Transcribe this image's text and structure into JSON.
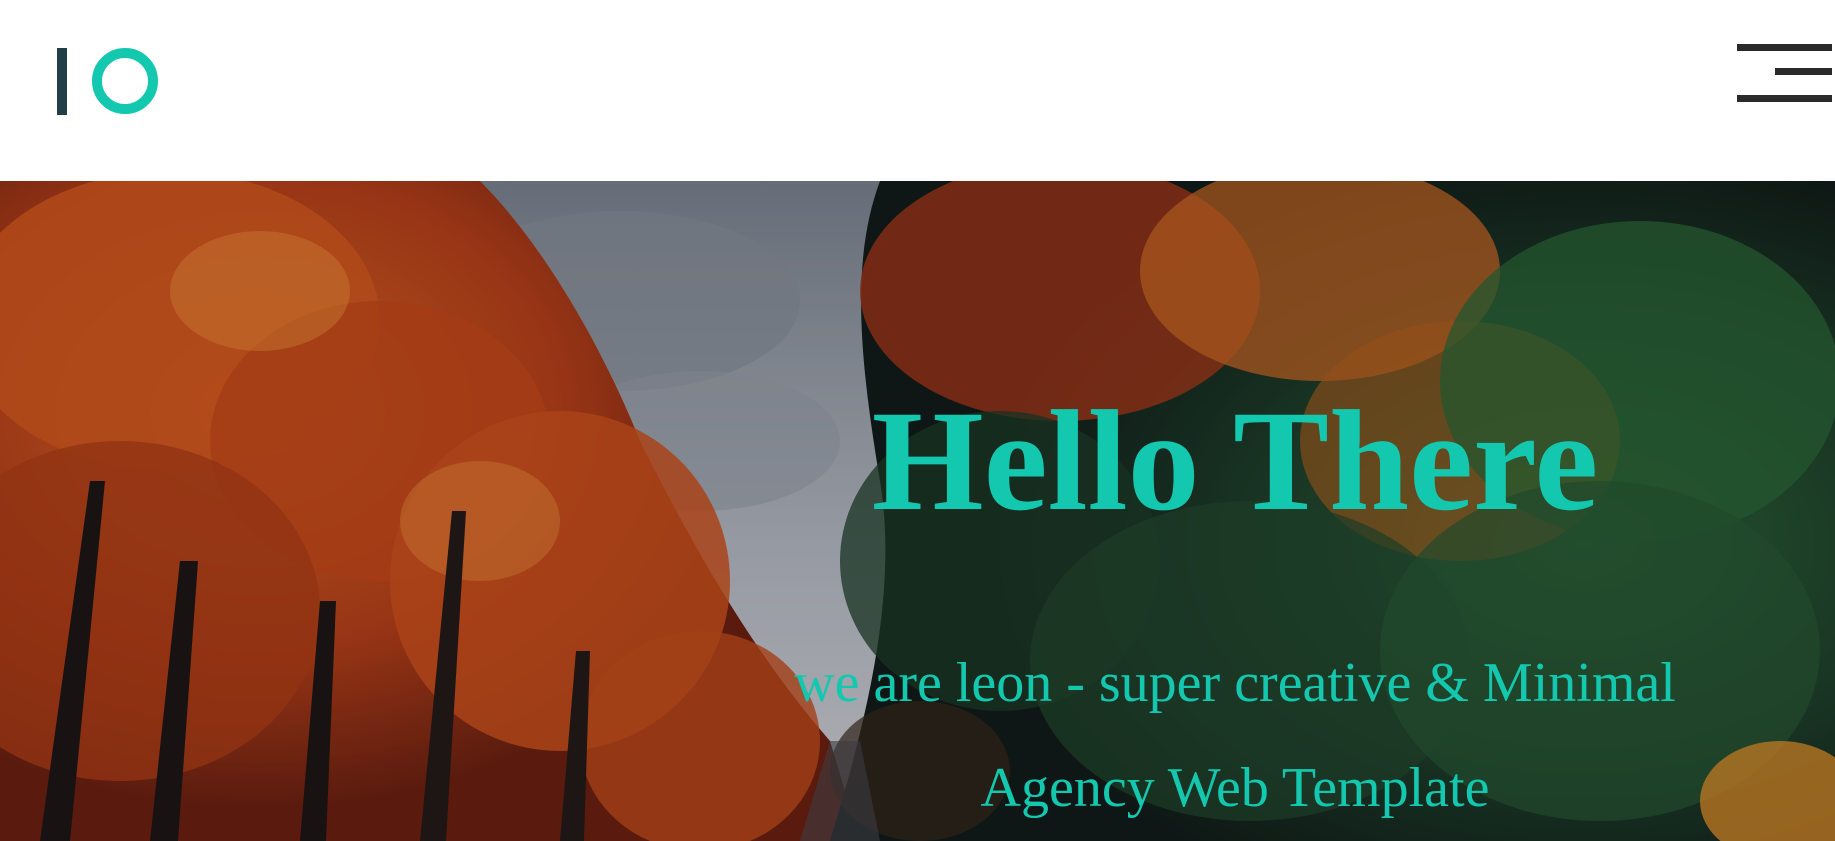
{
  "colors": {
    "accent": "#14c8b0",
    "logo_dark": "#1f3e45",
    "menu_dark": "#2a2a2a",
    "header_bg": "#ffffff"
  },
  "header": {
    "logo_icon": "io-logo-icon",
    "menu_icon": "hamburger-menu-icon"
  },
  "hero": {
    "title": "Hello There",
    "subtitle": "we are leon - super creative & Minimal Agency Web Template",
    "background_icon": "autumn-trees-photo"
  }
}
